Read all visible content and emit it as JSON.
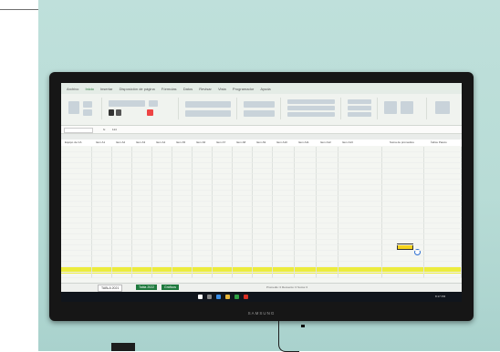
{
  "scene": {
    "kind": "photo of a wall-mounted television showing a spreadsheet application",
    "monitor": {
      "brand_label": "SAMSUNG"
    },
    "spreadsheet": {
      "ribbon_tabs": [
        "Archivo",
        "Inicio",
        "Insertar",
        "Disposición de página",
        "Fórmulas",
        "Datos",
        "Revisar",
        "Vista",
        "Programador",
        "Ayuda"
      ],
      "formula_bar": {
        "name_box": "",
        "fx_label": "fx",
        "value": "114"
      },
      "column_header_labels": [
        "Equipo de CA",
        "Item A1",
        "Item A2",
        "Item A3",
        "Item A4",
        "Item A5",
        "Item A6",
        "Item A7",
        "Item A8",
        "Item A9",
        "Item A10",
        "Item A11",
        "Item A12",
        "Item A13",
        "Suma de promedios",
        "Índice Pareto"
      ],
      "sheet_tabs": [
        "TABLA 2021",
        "Tabla 2022",
        "Gráficos"
      ],
      "highlight_row_color": "#ecec3c",
      "selected_cell_color": "#f5d31c",
      "status_bar_text": "Promedio: 0  Recuento: 0  Suma: 0"
    },
    "taskbar": {
      "clock": "8:17 PM"
    }
  }
}
